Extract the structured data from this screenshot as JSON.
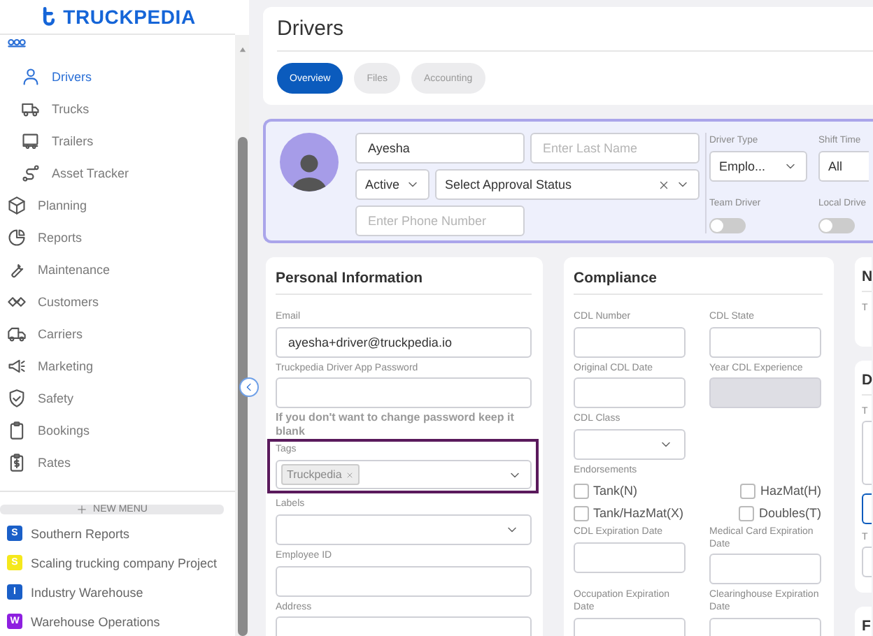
{
  "sidebar": {
    "logo": "TRUCKPEDIA",
    "items": [
      {
        "children": [
          {
            "label": "Drivers",
            "selected": true
          },
          {
            "label": "Trucks",
            "selected": false
          },
          {
            "label": "Trailers",
            "selected": false
          },
          {
            "label": "Asset Tracker",
            "selected": false
          }
        ]
      },
      {
        "label": "Planning",
        "selected": false
      },
      {
        "label": "Reports",
        "selected": false
      },
      {
        "label": "Maintenance",
        "selected": false
      },
      {
        "label": "Customers",
        "selected": false
      },
      {
        "label": "Carriers",
        "selected": false
      },
      {
        "label": "Marketing",
        "selected": false
      },
      {
        "label": "Safety",
        "selected": false
      },
      {
        "label": "Bookings",
        "selected": false
      },
      {
        "label": "Rates",
        "selected": false
      }
    ],
    "new_menu": "NEW MENU",
    "projects": [
      {
        "letter": "S",
        "name": "Southern Reports",
        "color": "#1a5fc8"
      },
      {
        "letter": "S",
        "name": "Scaling trucking company Project",
        "color": "#f5e81c"
      },
      {
        "letter": "I",
        "name": "Industry Warehouse",
        "color": "#1a5fc8"
      },
      {
        "letter": "W",
        "name": "Warehouse Operations",
        "color": "#8e1fe0"
      }
    ]
  },
  "header": {
    "title": "Drivers",
    "tabs": [
      {
        "label": "Overview",
        "selected": true
      },
      {
        "label": "Files",
        "selected": false
      },
      {
        "label": "Accounting",
        "selected": false
      }
    ]
  },
  "profile": {
    "first_name": {
      "value": "Ayesha"
    },
    "last_name": {
      "placeholder": "Enter Last Name"
    },
    "status": {
      "value": "Active"
    },
    "approval": {
      "value": "Select Approval Status"
    },
    "phone": {
      "placeholder": "Enter Phone Number"
    },
    "driver_type": {
      "label": "Driver Type",
      "value": "Emplo..."
    },
    "shift_time": {
      "label": "Shift Time",
      "value": "All"
    },
    "toggles": [
      {
        "label": "Team Driver",
        "on": false
      },
      {
        "label": "Local Drive",
        "on": false
      }
    ]
  },
  "personal": {
    "title": "Personal Information",
    "fields": [
      {
        "kind": "input",
        "label": "Email",
        "value": "ayesha+driver@truckpedia.io"
      },
      {
        "kind": "input",
        "label": "Truckpedia Driver App Password"
      },
      {
        "kind": "note",
        "text": "If you don't want to change password keep it blank"
      },
      {
        "kind": "tags",
        "label": "Tags",
        "chips": [
          "Truckpedia"
        ],
        "highlighted": true
      },
      {
        "kind": "select",
        "label": "Labels"
      },
      {
        "kind": "input",
        "label": "Employee ID"
      },
      {
        "kind": "input",
        "label": "Address"
      }
    ]
  },
  "compliance": {
    "title": "Compliance",
    "fields": [
      {
        "kind": "input",
        "label": "CDL Number",
        "disabled": false
      },
      {
        "kind": "input",
        "label": "CDL State",
        "disabled": false
      },
      {
        "kind": "input",
        "label": "Original CDL Date",
        "disabled": false
      },
      {
        "kind": "input",
        "label": "Year CDL Experience",
        "disabled": true
      },
      {
        "kind": "select",
        "label": "CDL Class",
        "disabled": false
      },
      {
        "kind": "checks",
        "label": "Endorsements",
        "options": [
          {
            "label": "Tank(N)",
            "checked": false
          },
          {
            "label": "HazMat(H)",
            "checked": false
          },
          {
            "label": "Tank/HazMat(X)",
            "checked": false
          },
          {
            "label": "Doubles(T)",
            "checked": false
          }
        ]
      },
      {
        "kind": "input",
        "label": "CDL Expiration Date",
        "disabled": false
      },
      {
        "kind": "input",
        "label": "Medical Card Expiration Date",
        "disabled": false
      },
      {
        "kind": "input",
        "label": "Occupation Expiration Date",
        "disabled": false
      },
      {
        "kind": "input",
        "label": "Clearinghouse Expiration Date",
        "disabled": false
      }
    ]
  },
  "edge_cards": [
    {
      "title": "N",
      "fields": [
        {
          "kind": "text",
          "label": "T"
        }
      ]
    },
    {
      "title": "D",
      "fields": [
        {
          "kind": "textarea",
          "label": "T"
        },
        {
          "kind": "input"
        },
        {
          "kind": "input",
          "label": "T"
        }
      ]
    },
    {
      "title": "F"
    }
  ]
}
